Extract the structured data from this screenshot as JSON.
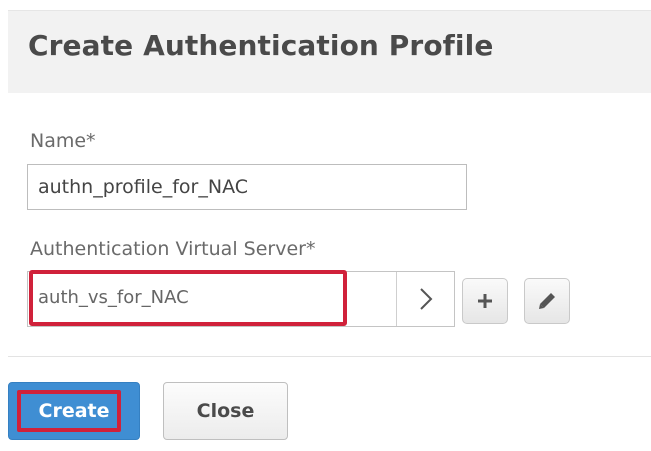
{
  "dialog": {
    "title": "Create Authentication Profile"
  },
  "form": {
    "name_label": "Name*",
    "name_value": "authn_profile_for_NAC",
    "vs_label": "Authentication Virtual Server*",
    "vs_value": "auth_vs_for_NAC"
  },
  "icons": {
    "vs_arrow": "chevron-right-icon",
    "add": "plus-icon",
    "edit": "pencil-icon"
  },
  "buttons": {
    "create_label": "Create",
    "close_label": "Close"
  },
  "colors": {
    "primary": "#3f8ed3",
    "highlight": "#d0213a",
    "header_bg": "#f2f2f2"
  }
}
